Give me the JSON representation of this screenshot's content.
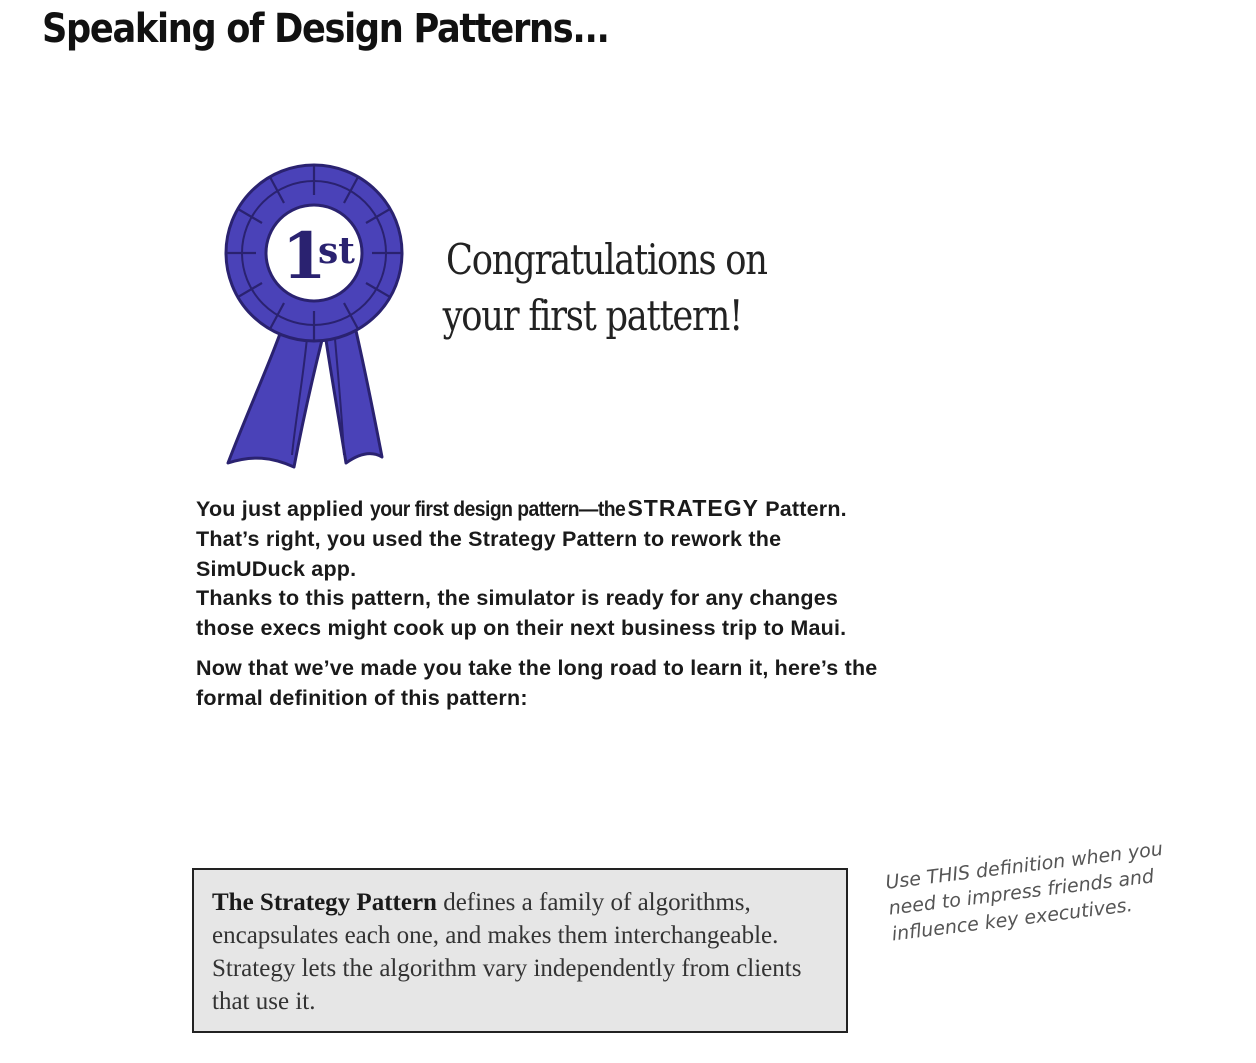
{
  "page": {
    "title": "Speaking of Design Patterns..."
  },
  "ribbon": {
    "label_number": "1",
    "label_suffix": "st"
  },
  "congrats": {
    "line1": "Congratulations on",
    "line2": "your first pattern!"
  },
  "body": {
    "p1_intro": "You just applied ",
    "p1_narrow": "your first design pattern—the",
    "p1_strategy": "STRATEGY",
    "p1_rest": "Pattern. That’s right, you used the Strategy Pattern to rework the SimUDuck app.",
    "p2": "Thanks to this pattern, the simulator is ready for any changes those execs might cook up on their next business trip to Maui.",
    "p3": "Now that we’ve made you take the long road to learn it, here’s the formal definition of this pattern:"
  },
  "definition": {
    "name": "The Strategy Pattern",
    "text": " defines a family of algorithms, encapsulates each one, and makes them interchangeable. Strategy lets the algorithm vary independently from clients that use it."
  },
  "side_note": {
    "line1": "Use THIS definition when you",
    "line2": "need to impress friends and",
    "line3": "influence key executives."
  },
  "colors": {
    "ribbon_fill": "#4a42b8",
    "ribbon_dark": "#2a2270",
    "definition_bg": "#e6e6e6"
  }
}
